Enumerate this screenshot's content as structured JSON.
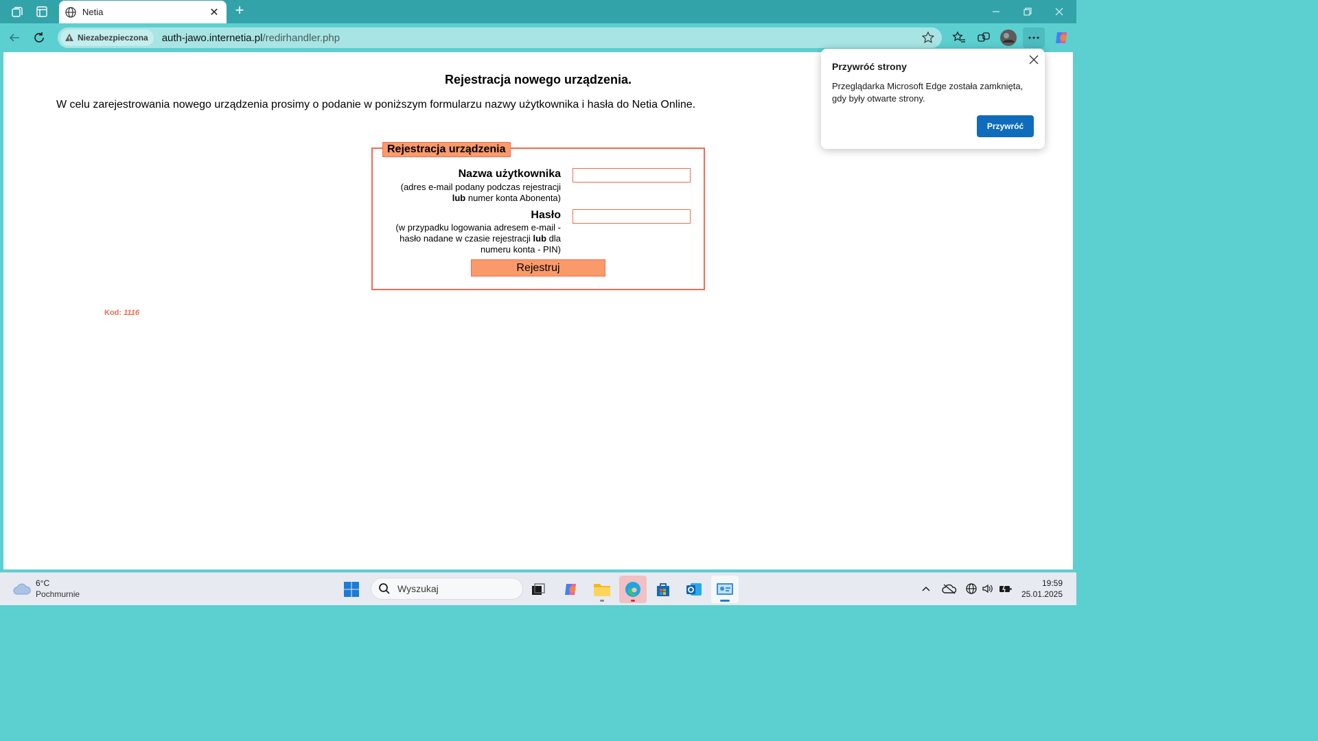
{
  "browser": {
    "tab_title": "Netia",
    "security_badge": "Niezabezpieczona",
    "url_host": "auth-jawo.internetia.pl",
    "url_path": "/redirhandler.php",
    "icons": [
      "workspaces-icon",
      "tab-actions-icon",
      "globe-icon",
      "close-icon",
      "new-tab-icon",
      "minimize-icon",
      "restore-icon",
      "window-close-icon",
      "back-icon",
      "reload-icon",
      "warning-icon",
      "favorite-star-icon",
      "favorites-icon",
      "collections-icon",
      "profile-avatar",
      "more-icon",
      "copilot-icon"
    ]
  },
  "page": {
    "heading": "Rejestracja nowego urządzenia.",
    "intro": "W celu zarejestrowania nowego urządzenia prosimy o podanie w poniższym formularzu nazwy użytkownika i hasła do Netia Online.",
    "form": {
      "legend": "Rejestracja urządzenia",
      "username_label": "Nazwa użytkownika",
      "username_hint_line1": "(adres e-mail podany podczas rejestracji",
      "username_hint_bold": "lub",
      "username_hint_line2": " numer konta Abonenta)",
      "username_value": "",
      "password_label": "Hasło",
      "password_hint_line1": "(w przypadku logowania adresem e-mail -",
      "password_hint_line2a": "hasło nadane w czasie rejestracji ",
      "password_hint_bold": "lub",
      "password_hint_line2b": " dla",
      "password_hint_line3": "numeru konta - PIN)",
      "password_value": "",
      "submit_label": "Rejestruj"
    },
    "code_label": "Kod:",
    "code_value": "1116"
  },
  "popup": {
    "title": "Przywróć strony",
    "text": "Przeglądarka Microsoft Edge została zamknięta, gdy były otwarte strony.",
    "button": "Przywróć"
  },
  "taskbar": {
    "weather_temp": "6°C",
    "weather_desc": "Pochmurnie",
    "search_placeholder": "Wyszukaj",
    "time": "19:59",
    "date": "25.01.2025",
    "apps": [
      "start",
      "task-view",
      "copilot",
      "file-explorer",
      "edge",
      "microsoft-store",
      "outlook",
      "control-panel"
    ]
  },
  "colors": {
    "accent_orange": "#fa9a6a",
    "border_orange": "#f26a4d",
    "edge_teal": "#5ccfd0",
    "button_blue": "#0f6cbd"
  }
}
